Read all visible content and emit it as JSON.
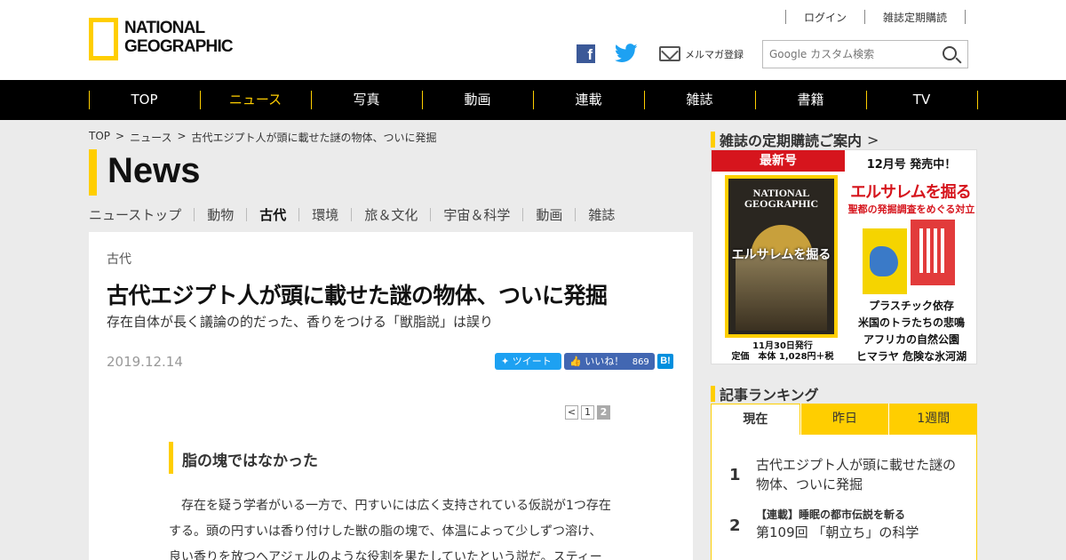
{
  "header": {
    "logo_line1": "NATIONAL",
    "logo_line2": "GEOGRAPHIC",
    "login": "ログイン",
    "subscribe": "雑誌定期購読",
    "mail_label": "メルマガ登録",
    "search_placeholder": "Google カスタム検索"
  },
  "nav": [
    "TOP",
    "ニュース",
    "写真",
    "動画",
    "連載",
    "雑誌",
    "書籍",
    "TV"
  ],
  "accent": "#ffce00",
  "breadcrumb": [
    "TOP",
    "ニュース",
    "古代エジプト人が頭に載せた謎の物体、ついに発掘"
  ],
  "section_title": "News",
  "subnav": [
    "ニューストップ",
    "動物",
    "古代",
    "環境",
    "旅＆文化",
    "宇宙＆科学",
    "動画",
    "雑誌"
  ],
  "article": {
    "category": "古代",
    "title": "古代エジプト人が頭に載せた謎の物体、ついに発掘",
    "subtitle": "存在自体が長く議論の的だった、香りをつける「獣脂説」は誤り",
    "date": "2019.12.14",
    "tweet": "ツイート",
    "like": "いいね！",
    "like_count": "869",
    "hatena": "B!",
    "pager": [
      "<",
      "1",
      "2"
    ],
    "section_heading": "脂の塊ではなかった",
    "body": [
      "　存在を疑う学者がいる一方で、円すいには広く支持されている仮説が1つ存在",
      "する。頭の円すいは香り付けした獣の脂の塊で、体温によって少しずつ溶け、",
      "良い香りを放つヘアジェルのような役割を果たしていたという説だ。スティー"
    ]
  },
  "sidebar": {
    "magazine_heading": "雑誌の定期購読ご案内",
    "latest": "最新号",
    "issue": "12月号 発売中！",
    "cover_logo1": "NATIONAL",
    "cover_logo2": "GEOGRAPHIC",
    "cover_title": "エルサレムを掘る",
    "feature": "エルサレムを掘る",
    "feature_sub": "聖都の発掘調査をめぐる対立",
    "topics": [
      "プラスチック依存",
      "米国のトラたちの悲鳴",
      "アフリカの自然公園",
      "ヒマラヤ 危険な氷河湖"
    ],
    "pub_date": "11月30日発行",
    "price": "定価　本体 1,028円＋税",
    "ranking_heading": "記事ランキング",
    "ranking_tabs": [
      "現在",
      "昨日",
      "1週間"
    ],
    "ranking": [
      {
        "num": "1",
        "series": "",
        "text": "古代エジプト人が頭に載せた謎の物体、ついに発掘"
      },
      {
        "num": "2",
        "series": "【連載】睡眠の都市伝説を斬る",
        "text": "第109回 「朝立ち」の科学"
      }
    ]
  }
}
